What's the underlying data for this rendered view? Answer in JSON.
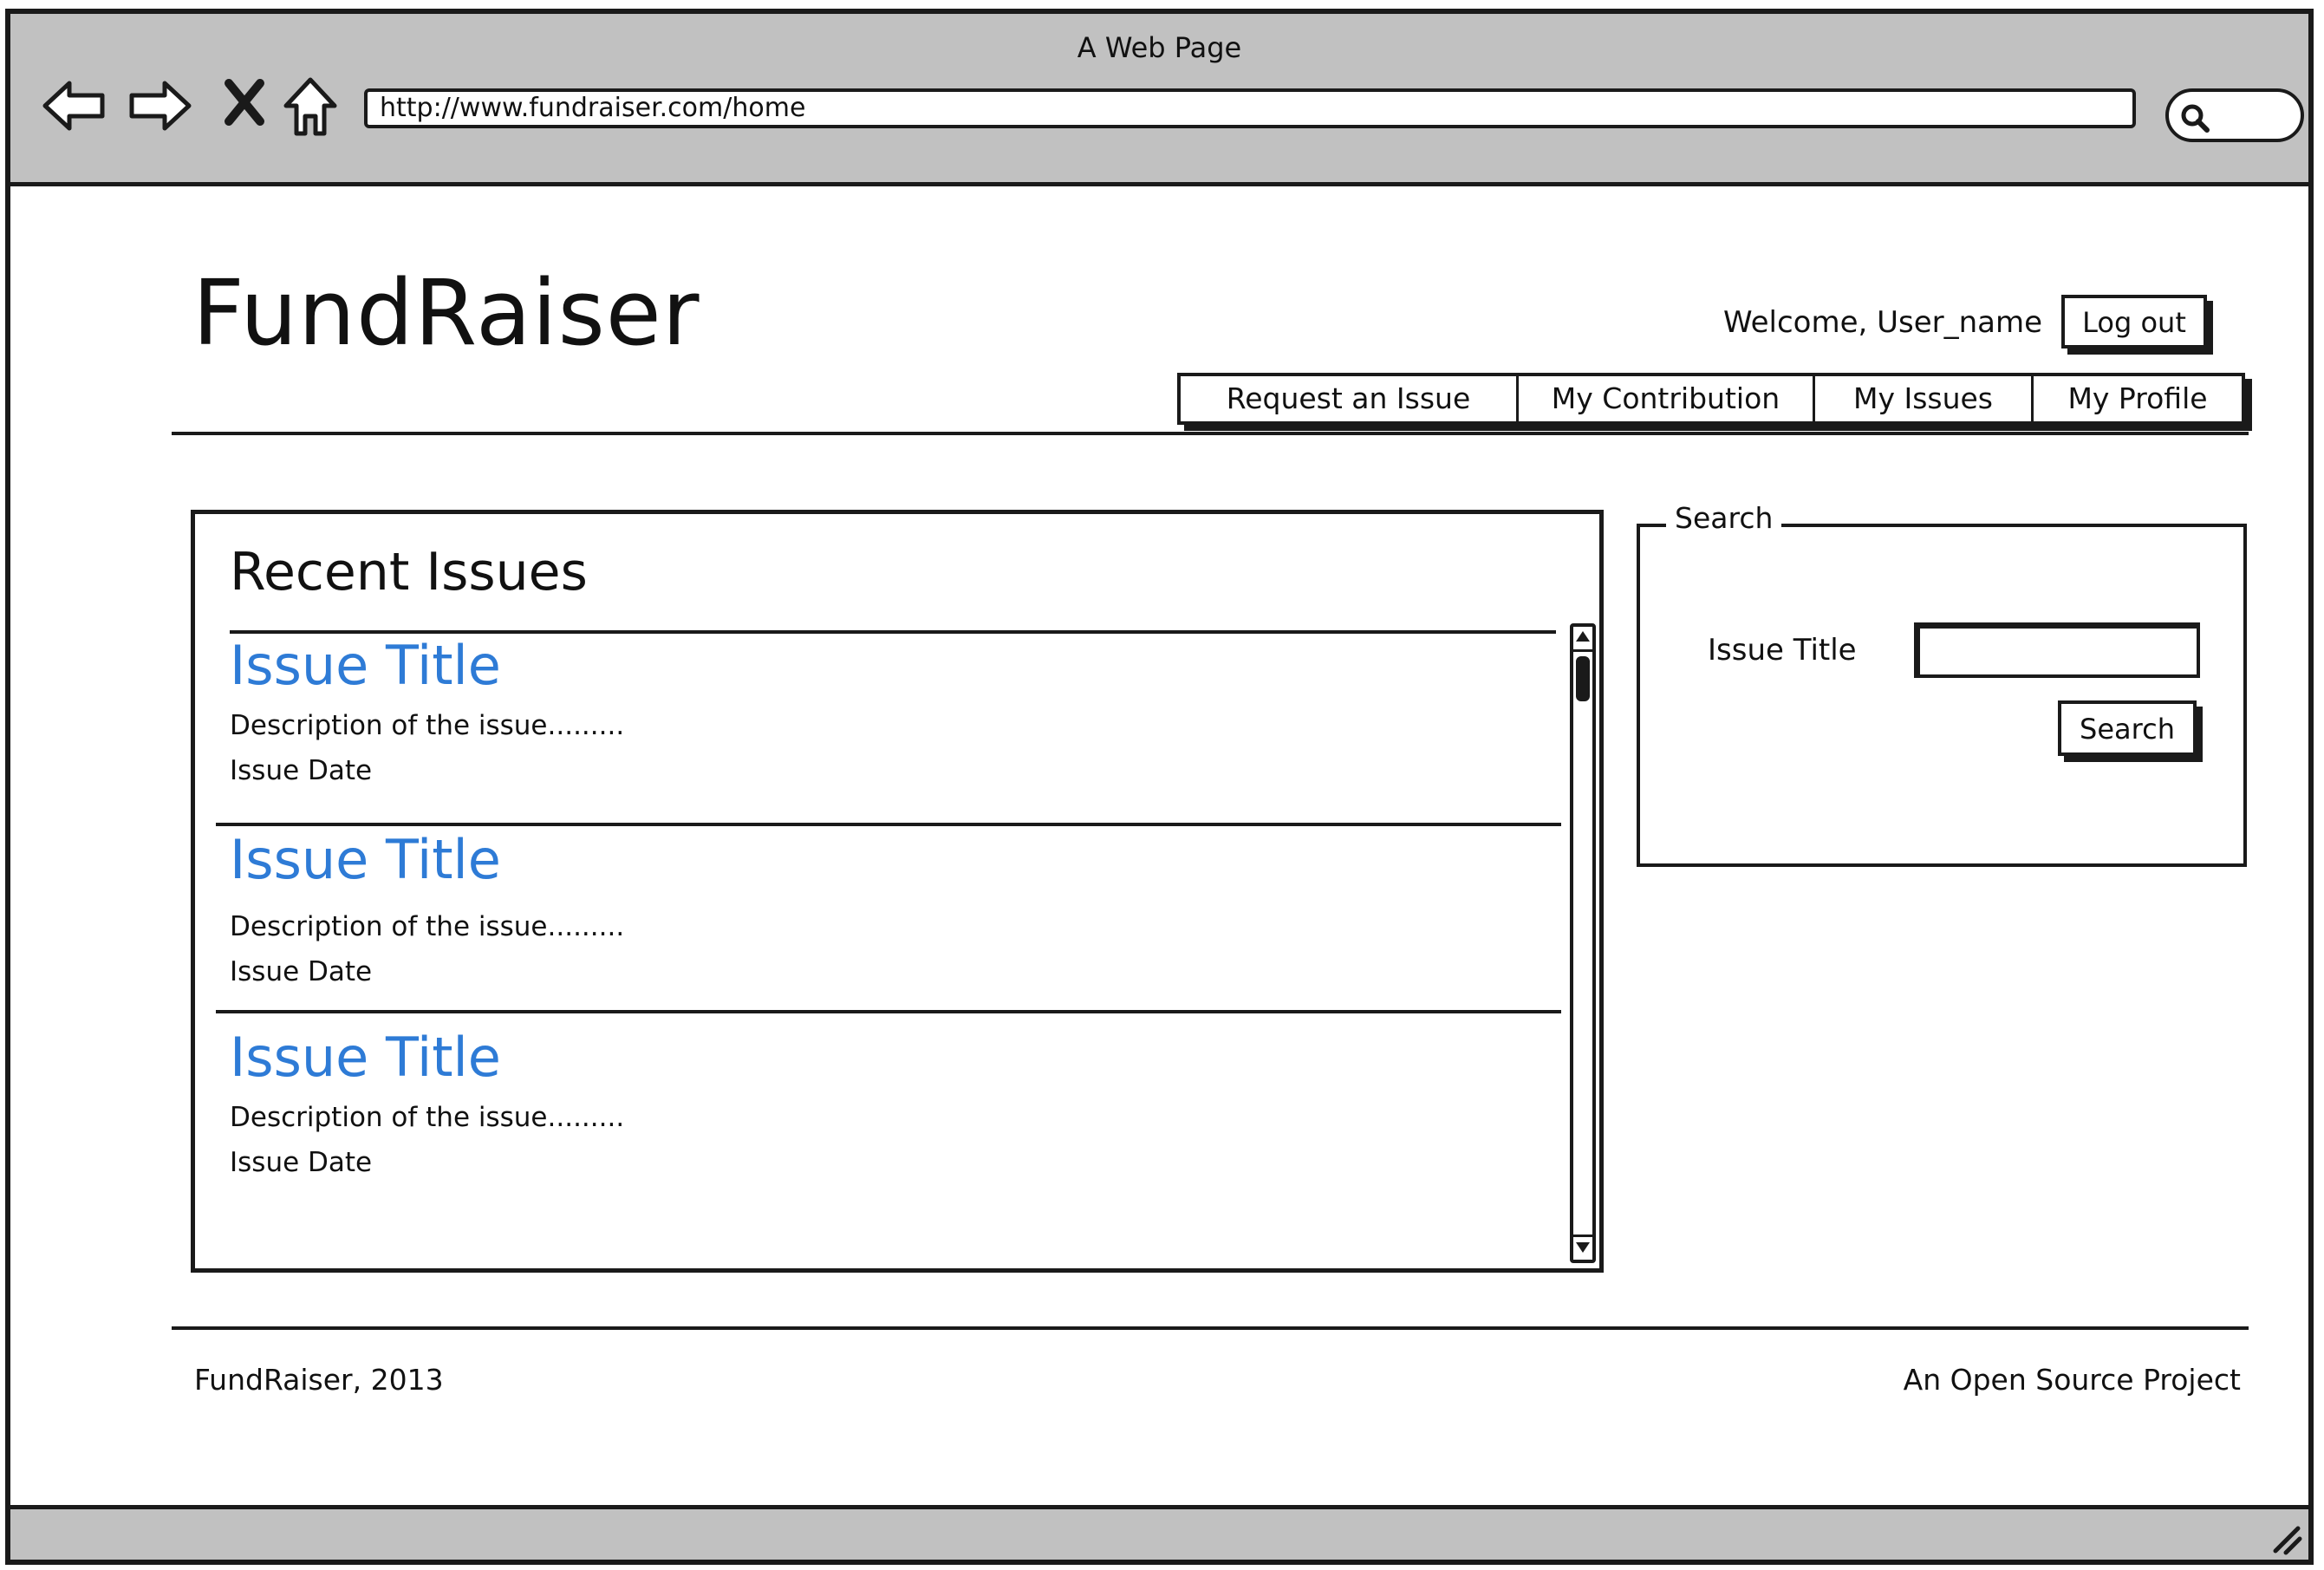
{
  "window": {
    "title": "A Web Page",
    "url": "http://www.fundraiser.com/home"
  },
  "browser_icons": [
    "back-arrow-icon",
    "forward-arrow-icon",
    "close-x-icon",
    "home-icon",
    "search-icon",
    "resize-grip-icon"
  ],
  "header": {
    "logo": "FundRaiser",
    "welcome": "Welcome, User_name",
    "logout_label": "Log out"
  },
  "nav": {
    "tabs": [
      {
        "label": "Request an Issue"
      },
      {
        "label": "My Contribution"
      },
      {
        "label": "My Issues"
      },
      {
        "label": "My Profile"
      }
    ]
  },
  "recent": {
    "heading": "Recent Issues",
    "issues": [
      {
        "title": "Issue Title",
        "description": "Description of the issue.........",
        "date": "Issue Date"
      },
      {
        "title": "Issue Title",
        "description": "Description of the issue.........",
        "date": "Issue Date"
      },
      {
        "title": "Issue Title",
        "description": "Description of the issue.........",
        "date": "Issue Date"
      }
    ]
  },
  "search": {
    "legend": "Search",
    "field_label": "Issue Title",
    "input_value": "",
    "button_label": "Search"
  },
  "footer": {
    "left": "FundRaiser, 2013",
    "right": "An Open Source Project"
  },
  "colors": {
    "link": "#2e7bd6",
    "chrome": "#c1c1c1",
    "ink": "#1a1a1a"
  }
}
